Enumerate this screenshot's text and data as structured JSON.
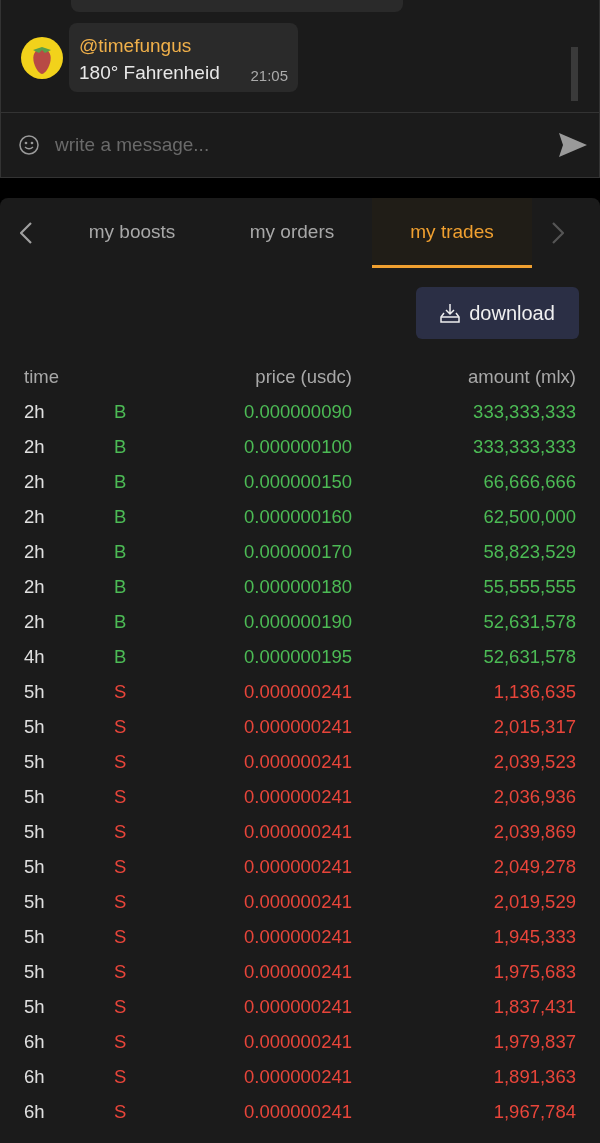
{
  "chat": {
    "message": {
      "author": "@timefungus",
      "text": "180° Fahrenheid",
      "time": "21:05"
    },
    "composer": {
      "placeholder": "write a message..."
    }
  },
  "trades_panel": {
    "tabs": [
      {
        "label": "my boosts",
        "selected": false
      },
      {
        "label": "my orders",
        "selected": false
      },
      {
        "label": "my trades",
        "selected": true
      }
    ],
    "download_button": "download",
    "table": {
      "columns": [
        "time",
        "price (usdc)",
        "amount (mlx)"
      ],
      "rows": [
        {
          "time": "2h",
          "side": "B",
          "kind": "buy",
          "price": "0.000000090",
          "amount": "333,333,333"
        },
        {
          "time": "2h",
          "side": "B",
          "kind": "buy",
          "price": "0.000000100",
          "amount": "333,333,333"
        },
        {
          "time": "2h",
          "side": "B",
          "kind": "buy",
          "price": "0.000000150",
          "amount": "66,666,666"
        },
        {
          "time": "2h",
          "side": "B",
          "kind": "buy",
          "price": "0.000000160",
          "amount": "62,500,000"
        },
        {
          "time": "2h",
          "side": "B",
          "kind": "buy",
          "price": "0.000000170",
          "amount": "58,823,529"
        },
        {
          "time": "2h",
          "side": "B",
          "kind": "buy",
          "price": "0.000000180",
          "amount": "55,555,555"
        },
        {
          "time": "2h",
          "side": "B",
          "kind": "buy",
          "price": "0.000000190",
          "amount": "52,631,578"
        },
        {
          "time": "4h",
          "side": "B",
          "kind": "buy",
          "price": "0.000000195",
          "amount": "52,631,578"
        },
        {
          "time": "5h",
          "side": "S",
          "kind": "sell",
          "price": "0.000000241",
          "amount": "1,136,635"
        },
        {
          "time": "5h",
          "side": "S",
          "kind": "sell",
          "price": "0.000000241",
          "amount": "2,015,317"
        },
        {
          "time": "5h",
          "side": "S",
          "kind": "sell",
          "price": "0.000000241",
          "amount": "2,039,523"
        },
        {
          "time": "5h",
          "side": "S",
          "kind": "sell",
          "price": "0.000000241",
          "amount": "2,036,936"
        },
        {
          "time": "5h",
          "side": "S",
          "kind": "sell",
          "price": "0.000000241",
          "amount": "2,039,869"
        },
        {
          "time": "5h",
          "side": "S",
          "kind": "sell",
          "price": "0.000000241",
          "amount": "2,049,278"
        },
        {
          "time": "5h",
          "side": "S",
          "kind": "sell",
          "price": "0.000000241",
          "amount": "2,019,529"
        },
        {
          "time": "5h",
          "side": "S",
          "kind": "sell",
          "price": "0.000000241",
          "amount": "1,945,333"
        },
        {
          "time": "5h",
          "side": "S",
          "kind": "sell",
          "price": "0.000000241",
          "amount": "1,975,683"
        },
        {
          "time": "5h",
          "side": "S",
          "kind": "sell",
          "price": "0.000000241",
          "amount": "1,837,431"
        },
        {
          "time": "6h",
          "side": "S",
          "kind": "sell",
          "price": "0.000000241",
          "amount": "1,979,837"
        },
        {
          "time": "6h",
          "side": "S",
          "kind": "sell",
          "price": "0.000000241",
          "amount": "1,891,363"
        },
        {
          "time": "6h",
          "side": "S",
          "kind": "sell",
          "price": "0.000000241",
          "amount": "1,967,784"
        }
      ]
    }
  }
}
